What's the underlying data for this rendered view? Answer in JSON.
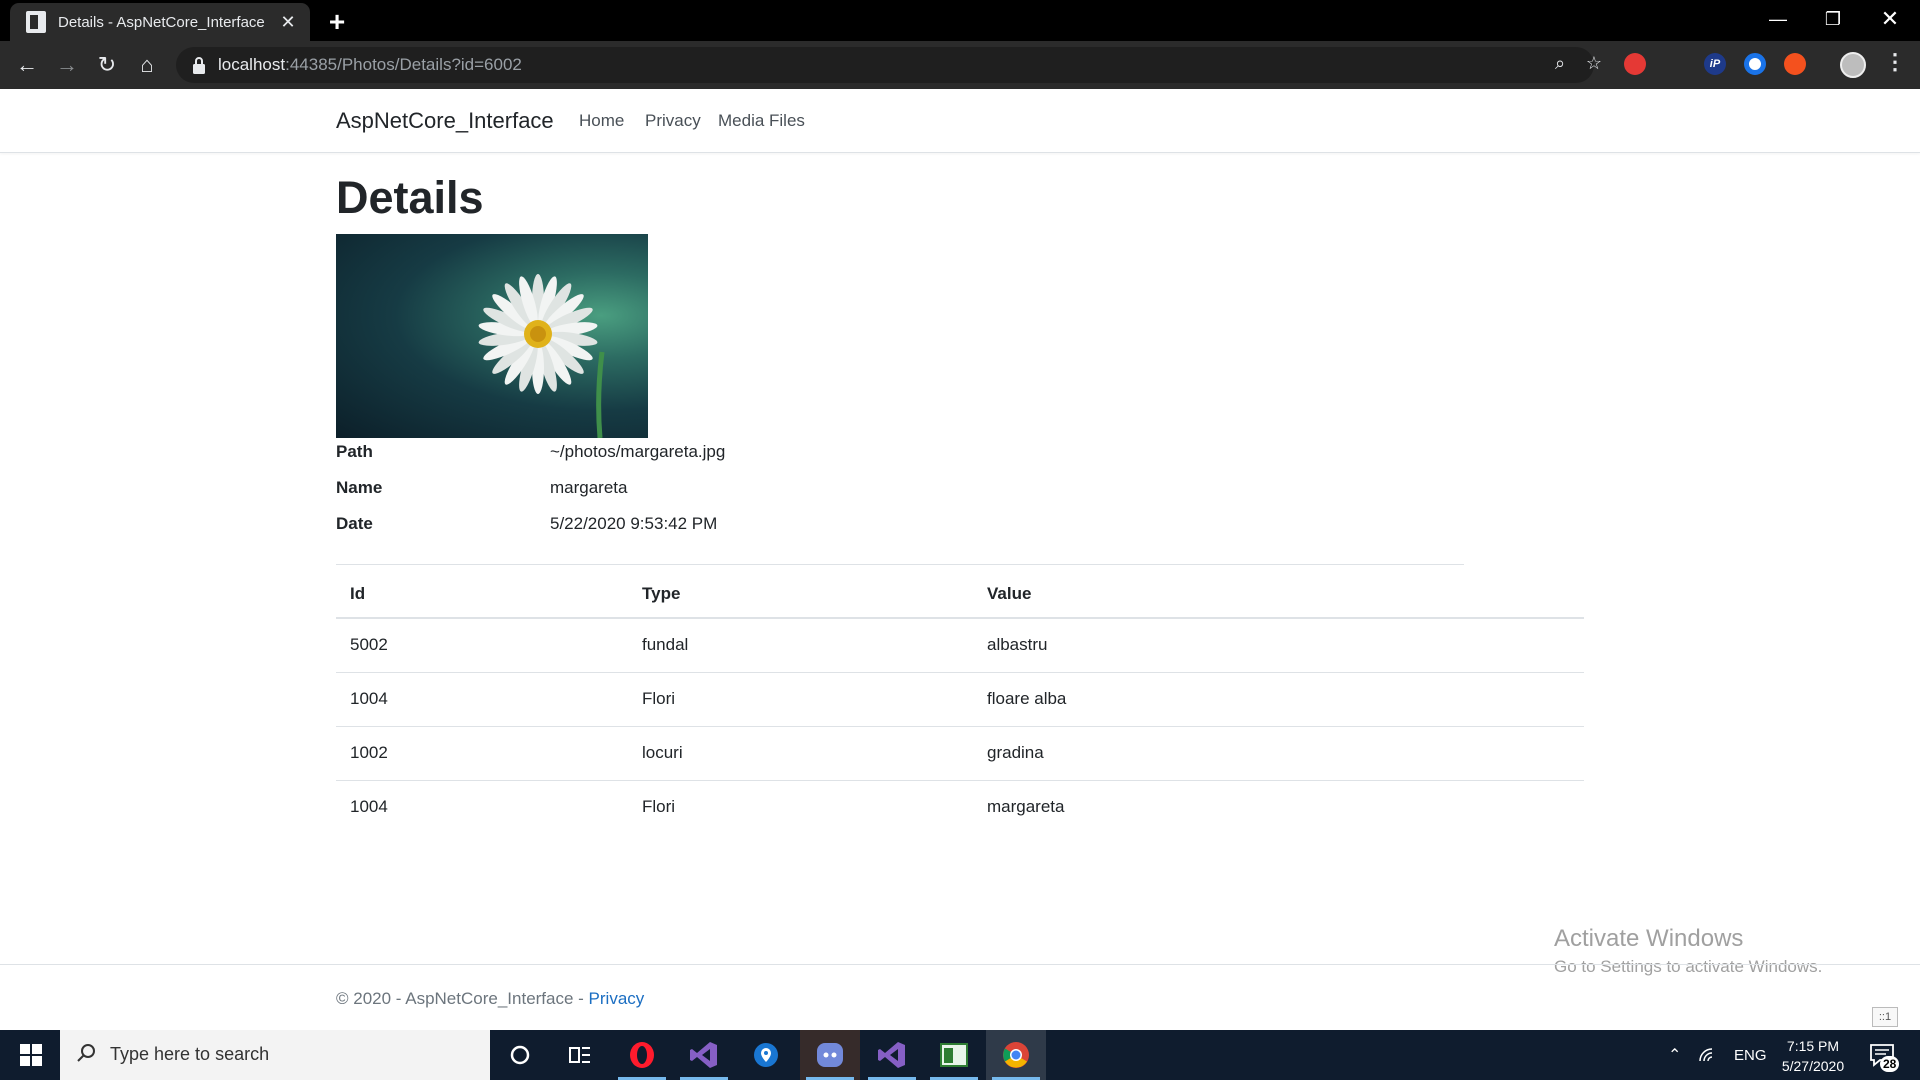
{
  "browser": {
    "tab_title": "Details - AspNetCore_Interface",
    "url_host": "localhost",
    "url_rest": ":44385/Photos/Details?id=6002",
    "ext_ip_label": "iP"
  },
  "site": {
    "brand": "AspNetCore_Interface",
    "nav": {
      "home": "Home",
      "privacy": "Privacy",
      "media": "Media Files"
    },
    "page_title": "Details",
    "details": {
      "path_label": "Path",
      "path_value": "~/photos/margareta.jpg",
      "name_label": "Name",
      "name_value": "margareta",
      "date_label": "Date",
      "date_value": "5/22/2020 9:53:42 PM"
    },
    "table": {
      "headers": {
        "id": "Id",
        "type": "Type",
        "value": "Value"
      },
      "rows": [
        {
          "id": "5002",
          "type": "fundal",
          "value": "albastru"
        },
        {
          "id": "1004",
          "type": "Flori",
          "value": "floare alba"
        },
        {
          "id": "1002",
          "type": "locuri",
          "value": "gradina"
        },
        {
          "id": "1004",
          "type": "Flori",
          "value": "margareta"
        }
      ]
    },
    "footer": {
      "text": "© 2020 - AspNetCore_Interface - ",
      "link": "Privacy"
    }
  },
  "watermark": {
    "title": "Activate Windows",
    "subtitle": "Go to Settings to activate Windows."
  },
  "scroll_badge": "::1",
  "taskbar": {
    "search_placeholder": "Type here to search",
    "lang": "ENG",
    "time": "7:15 PM",
    "date": "5/27/2020",
    "notifications": "28"
  },
  "colors": {
    "link": "#1b6ec2",
    "taskbar": "#0f1c2e",
    "browser_chrome": "#2b2b2b"
  }
}
